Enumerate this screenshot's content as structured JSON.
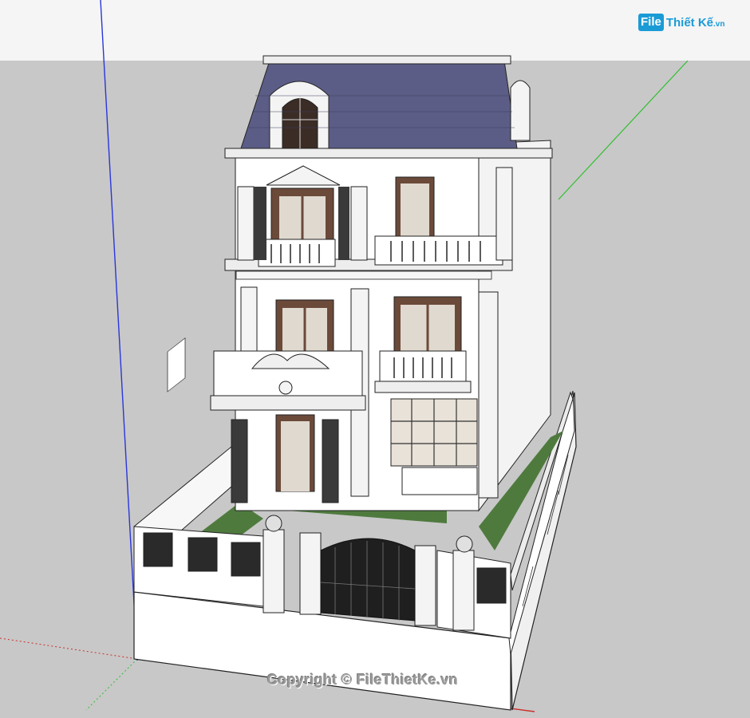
{
  "logo": {
    "badge": "File",
    "name": "Thiết Kế",
    "suffix": ".vn"
  },
  "watermark": "Copyright © FileThietKe.vn",
  "colors": {
    "sky": "#f5f5f5",
    "ground": "#c8c8c8",
    "roof": "#5b5d86",
    "wall": "#ffffff",
    "trim": "#e8e8e8",
    "column": "#3a3a3a",
    "window": "#6b4a3a",
    "glass": "#e0d9cf",
    "lawn": "#4f7a3e",
    "gate": "#1f1f1f",
    "axis_blue": "#2a36d8",
    "axis_green": "#2fbf2f",
    "axis_red": "#c9302c",
    "brand": "#1b9bd6"
  },
  "icons": [
    "filethietke-logo-icon"
  ]
}
